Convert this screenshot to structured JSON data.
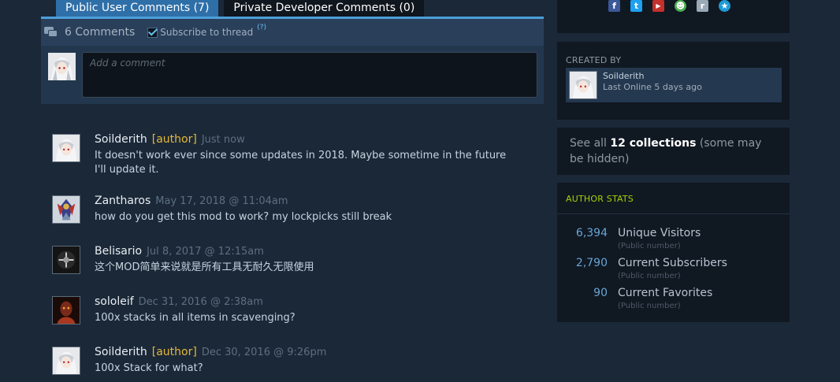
{
  "tabs": {
    "public": "Public User Comments (7)",
    "private": "Private Developer Comments (0)"
  },
  "comments_header": {
    "count": "6 Comments",
    "subscribe": "Subscribe to thread",
    "help": "(?)"
  },
  "comment_entry": {
    "placeholder": "Add a comment"
  },
  "comments": [
    {
      "author": "Soilderith",
      "tag": "[author]",
      "time": "Just now",
      "text": "It doesn't work ever since some updates in 2018. Maybe sometime in the future I'll update it."
    },
    {
      "author": "Zantharos",
      "tag": "",
      "time": "May 17, 2018 @ 11:04am",
      "text": "how do you get this mod to work? my lockpicks still break"
    },
    {
      "author": "Belisario",
      "tag": "",
      "time": "Jul 8, 2017 @ 12:15am",
      "text": "这个MOD简单来说就是所有工具无耐久无限使用"
    },
    {
      "author": "sololeif",
      "tag": "",
      "time": "Dec 31, 2016 @ 2:38am",
      "text": "100x stacks in all items in scavenging?"
    },
    {
      "author": "Soilderith",
      "tag": "[author]",
      "time": "Dec 30, 2016 @ 9:26pm",
      "text": "100x Stack for what?"
    }
  ],
  "share_icons": [
    {
      "icon": "facebook-icon",
      "glyph": "f",
      "color": "#3b5998"
    },
    {
      "icon": "twitter-icon",
      "glyph": "t",
      "color": "#1da1f2"
    },
    {
      "icon": "youtube-icon",
      "glyph": "▶",
      "color": "#c4302b"
    },
    {
      "icon": "smiley-icon",
      "glyph": "☻",
      "color": "#4caf50"
    },
    {
      "icon": "reddit-icon",
      "glyph": "r",
      "color": "#9aa9b6"
    },
    {
      "icon": "qzone-icon",
      "glyph": "★",
      "color": "#1e9ad6"
    }
  ],
  "created_by": {
    "label": "CREATED BY",
    "name": "Soilderith",
    "online": "Last Online 5 days ago"
  },
  "collections": {
    "prefix": "See all ",
    "count": "12 collections",
    "suffix": " (some may be hidden)"
  },
  "author_stats": {
    "title": "AUTHOR STATS",
    "items": [
      {
        "value": "6,394",
        "label": "Unique Visitors",
        "sub": "(Public number)"
      },
      {
        "value": "2,790",
        "label": "Current Subscribers",
        "sub": "(Public number)"
      },
      {
        "value": "90",
        "label": "Current Favorites",
        "sub": "(Public number)"
      }
    ]
  },
  "colors": {
    "background": "#1b2838",
    "accent": "#67c1f5",
    "author_tag": "#e4b83a",
    "stats_title": "#a4d007"
  }
}
